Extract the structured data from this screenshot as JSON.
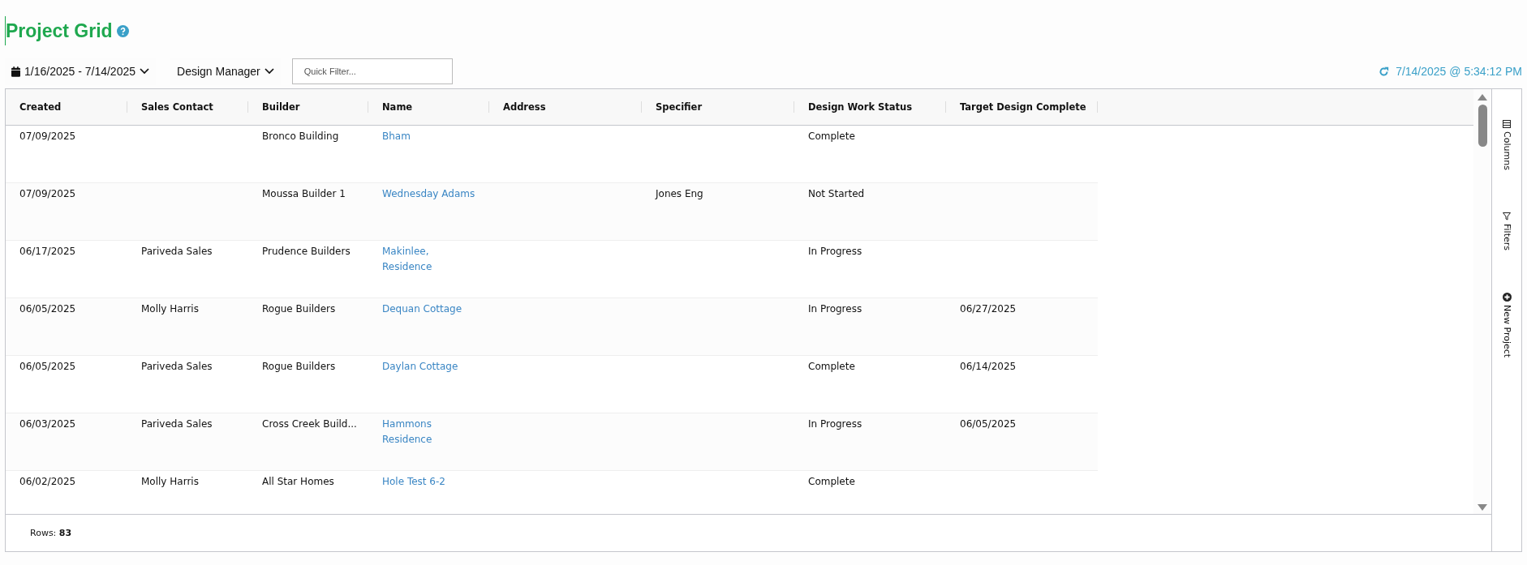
{
  "page": {
    "title": "Project Grid"
  },
  "toolbar": {
    "date_range": "1/16/2025 - 7/14/2025",
    "manager_filter": "Design Manager",
    "quick_filter": {
      "placeholder": "Quick Filter..."
    },
    "refreshed": "7/14/2025 @ 5:34:12 PM"
  },
  "table": {
    "columns": [
      "Created",
      "Sales Contact",
      "Builder",
      "Name",
      "Address",
      "Specifier",
      "Design Work Status",
      "Target Design Complete"
    ],
    "rows": [
      {
        "created": "07/09/2025",
        "sales_contact": "",
        "builder": "Bronco Building",
        "name": [
          "Bham"
        ],
        "address": "",
        "specifier": "",
        "status": "Complete",
        "target": ""
      },
      {
        "created": "07/09/2025",
        "sales_contact": "",
        "builder": "Moussa Builder 1",
        "name": [
          "Wednesday Adams"
        ],
        "address": "",
        "specifier": "Jones Eng",
        "status": "Not Started",
        "target": ""
      },
      {
        "created": "06/17/2025",
        "sales_contact": "Pariveda Sales",
        "builder": "Prudence Builders",
        "name": [
          "Makinlee,",
          "Residence"
        ],
        "address": "",
        "specifier": "",
        "status": "In Progress",
        "target": ""
      },
      {
        "created": "06/05/2025",
        "sales_contact": "Molly Harris",
        "builder": "Rogue Builders",
        "name": [
          "Dequan Cottage"
        ],
        "address": "",
        "specifier": "",
        "status": "In Progress",
        "target": "06/27/2025"
      },
      {
        "created": "06/05/2025",
        "sales_contact": "Pariveda Sales",
        "builder": "Rogue Builders",
        "name": [
          "Daylan Cottage"
        ],
        "address": "",
        "specifier": "",
        "status": "Complete",
        "target": "06/14/2025"
      },
      {
        "created": "06/03/2025",
        "sales_contact": "Pariveda Sales",
        "builder": "Cross Creek Build...",
        "name": [
          "Hammons",
          "Residence"
        ],
        "address": "",
        "specifier": "",
        "status": "In Progress",
        "target": "06/05/2025"
      },
      {
        "created": "06/02/2025",
        "sales_contact": "Molly Harris",
        "builder": "All Star Homes",
        "name": [
          "Hole Test 6-2"
        ],
        "address": "",
        "specifier": "",
        "status": "Complete",
        "target": ""
      }
    ]
  },
  "side_panel": [
    {
      "kind": "columns",
      "label": "Columns"
    },
    {
      "kind": "filters",
      "label": "Filters"
    },
    {
      "kind": "new",
      "label": "New Project"
    }
  ],
  "footer": {
    "rows_label": "Rows:",
    "rows_count": "83"
  }
}
